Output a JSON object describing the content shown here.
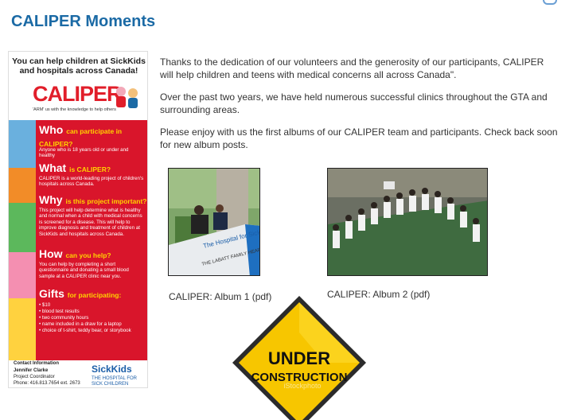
{
  "title": "CALIPER Moments",
  "poster": {
    "header": "You can help children at SickKids and hospitals across Canada!",
    "logo": "CALIPER",
    "tagline": "'ARM' us with the knowledge to help others",
    "sections": [
      {
        "heading": "Who",
        "sub": "can participate in CALIPER?",
        "text": "Anyone who is 18 years old or under and healthy"
      },
      {
        "heading": "What",
        "sub": "is CALIPER?",
        "text": "CALIPER is a world-leading project of children's hospitals across Canada."
      },
      {
        "heading": "Why",
        "sub": "is this project important?",
        "text": "This project will help determine what is healthy and normal when a child with medical concerns is screened for a disease. This will help to improve diagnosis and treatment of children at SickKids and hospitals across Canada."
      },
      {
        "heading": "How",
        "sub": "can you help?",
        "text": "You can help by completing a short questionnaire and donating a small blood sample at a CALIPER clinic near you."
      },
      {
        "heading": "Gifts",
        "sub": "for participating:",
        "items": [
          "$10",
          "blood test results",
          "two community hours",
          "name included in a draw for a laptop",
          "choice of t-shirt, teddy bear, or storybook"
        ]
      }
    ],
    "contact_title": "Contact Information",
    "contact_name": "Jennifer Clarke",
    "contact_role": "Project Coordinator",
    "contact_phone": "Phone: 416.813.7654 ext. 2673",
    "sponsor": "SickKids",
    "sponsor_sub": "THE HOSPITAL FOR SICK CHILDREN"
  },
  "paragraphs": [
    "Thanks to the dedication of our volunteers and the generosity of our participants, CALIPER will help children and teens with medical concerns all across Canada\".",
    "Over the past two years, we have held numerous successful clinics throughout the GTA and surrounding areas.",
    "Please enjoy with us the first albums of our CALIPER team and participants. Check back soon for new album posts."
  ],
  "albums": [
    {
      "label": "CALIPER: Album 1 (pdf)",
      "photo_sign": "The Hospital for Sick Children",
      "photo_sign2": "THE LABATT FAMILY HEART CENTRE"
    },
    {
      "label": "CALIPER: Album 2 (pdf)"
    }
  ],
  "construction": {
    "line1": "UNDER",
    "line2": "CONSTRUCTION",
    "watermark": "iStockphoto"
  },
  "colors": {
    "title": "#1b6aa5",
    "poster_red": "#d9152b",
    "sign_yellow": "#f7c600"
  }
}
